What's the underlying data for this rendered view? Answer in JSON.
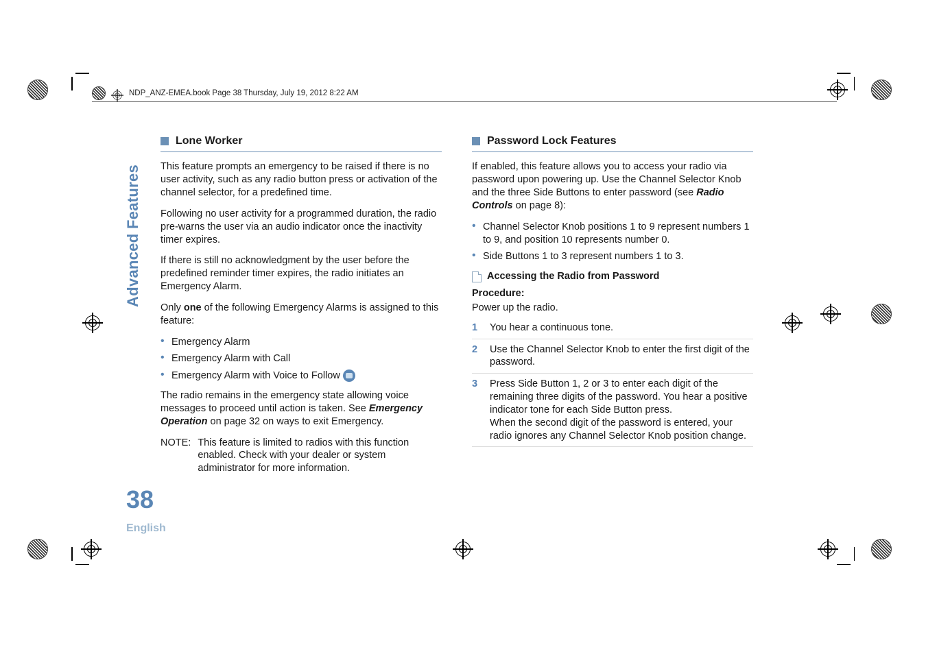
{
  "header": {
    "text": "NDP_ANZ-EMEA.book  Page 38  Thursday, July 19, 2012  8:22 AM"
  },
  "left": {
    "title": "Lone Worker",
    "p1": "This feature prompts an emergency to be raised if there is no user activity, such as any radio button press or activation of the channel selector, for a predefined time.",
    "p2": "Following no user activity for a programmed duration, the radio pre-warns the user via an audio indicator once the inactivity timer expires.",
    "p3": "If there is still no acknowledgment by the user before the predefined reminder timer expires, the radio initiates an Emergency Alarm.",
    "p4a": "Only ",
    "p4b": "one",
    "p4c": " of the following Emergency Alarms is assigned to this feature:",
    "bullets": [
      "Emergency Alarm",
      "Emergency Alarm with Call",
      "Emergency Alarm with Voice to Follow"
    ],
    "p5a": "The radio remains in the emergency state allowing voice messages to proceed until action is taken. See ",
    "p5b": "Emergency Operation",
    "p5c": " on page 32 on ways to exit Emergency.",
    "noteLabel": "NOTE:",
    "noteText": "This feature is limited to radios with this function enabled. Check with your dealer or system administrator for more information."
  },
  "right": {
    "title": "Password Lock Features",
    "p1a": "If enabled, this feature allows you to access your radio via password upon powering up. Use the Channel Selector Knob and the three Side Buttons to enter password (see ",
    "p1b": "Radio Controls",
    "p1c": " on page 8):",
    "bullets": [
      "Channel Selector Knob positions 1 to 9 represent numbers 1 to 9, and position 10 represents number 0.",
      "Side Buttons 1 to 3 represent numbers 1 to 3."
    ],
    "sub": "Accessing the Radio from Password",
    "procLabel": "Procedure:",
    "procIntro": "Power up the radio.",
    "steps": [
      "You hear a continuous tone.",
      "Use the Channel Selector Knob to enter the first digit of the password.",
      "Press Side Button 1, 2 or 3 to enter each digit of the remaining three digits of the password. You hear a positive indicator tone for each Side Button press.\nWhen the second digit of the password is entered, your radio ignores any Channel Selector Knob position change."
    ]
  },
  "spine": {
    "section": "Advanced Features"
  },
  "footer": {
    "page": "38",
    "lang": "English"
  }
}
